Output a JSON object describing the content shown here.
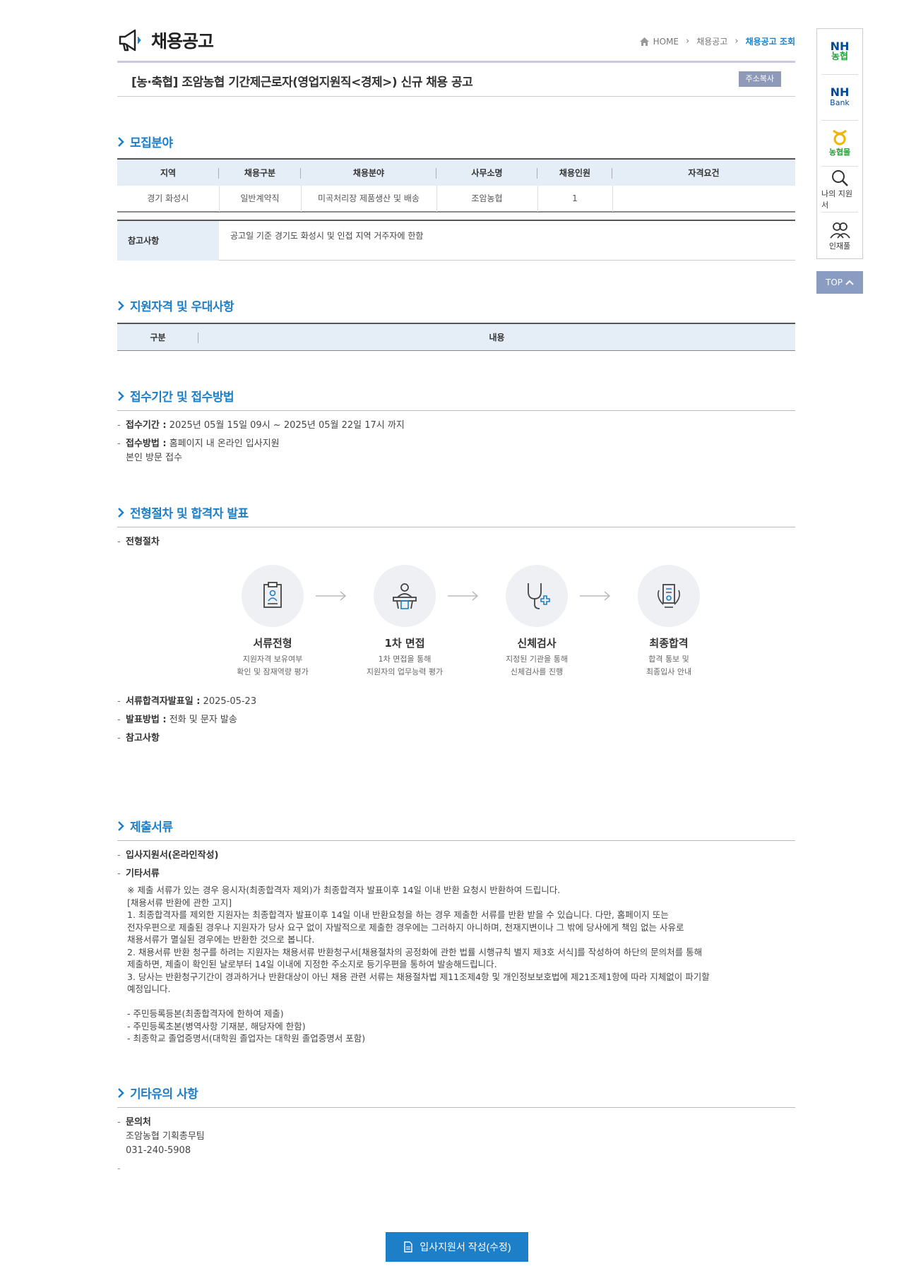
{
  "page": {
    "title": "채용공고",
    "breadcrumb": [
      "HOME",
      "채용공고",
      "채용공고 조회"
    ],
    "subject": "[농·축협] 조암농협 기간제근로자(영업지원직<경제>) 신규 채용 공고",
    "copy_button": "주소복사"
  },
  "sections": {
    "recruit": "모집분야",
    "qualification": "지원자격 및 우대사항",
    "reception": "접수기간 및 접수방법",
    "selection": "전형절차 및 합격자 발표",
    "documents": "제출서류",
    "etc": "기타유의 사항"
  },
  "recruit_table": {
    "headers": [
      "지역",
      "채용구분",
      "채용분야",
      "사무소명",
      "채용인원",
      "자격요건"
    ],
    "rows": [
      [
        "경기 화성시",
        "일반계약직",
        "미곡처리장 제품생산 및 배송",
        "조암농협",
        "1",
        ""
      ]
    ]
  },
  "note": {
    "label": "참고사항",
    "text": "공고일 기준 경기도 화성시 및 인접 지역 거주자에 한함"
  },
  "qual_table": {
    "headers": [
      "구분",
      "내용"
    ]
  },
  "reception": {
    "period_label": "접수기간 :",
    "period": "2025년 05월 15일 09시 ~ 2025년 05월 22일 17시 까지",
    "method_label": "접수방법 :",
    "method": "홈페이지 내 온라인 입사지원",
    "method2": "본인 방문 접수"
  },
  "selection": {
    "process_label": "전형절차",
    "steps": [
      {
        "title": "서류전형",
        "desc1": "지원자격 보유여부",
        "desc2": "확인 및 잠재역량 평가",
        "icon": "document-icon"
      },
      {
        "title": "1차 면접",
        "desc1": "1차 면접을 통해",
        "desc2": "지원자의 업무능력 평가",
        "icon": "interview-icon"
      },
      {
        "title": "신체검사",
        "desc1": "지정된 기관을 통해",
        "desc2": "신체검사를 진행",
        "icon": "stethoscope-icon"
      },
      {
        "title": "최종합격",
        "desc1": "합격 통보 및",
        "desc2": "최종입사 안내",
        "icon": "award-icon"
      }
    ],
    "doc_date_label": "서류합격자발표일 :",
    "doc_date": "2025-05-23",
    "announce_label": "발표방법 :",
    "announce": "전화 및 문자 발송",
    "note_label": "참고사항"
  },
  "documents": {
    "item1": "입사지원서(온라인작성)",
    "item2": "기타서류",
    "lines": [
      "※ 제출 서류가 있는 경우 응시자(최종합격자 제외)가 최종합격자 발표이후 14일 이내 반환 요청시 반환하여 드립니다.",
      "[채용서류 반환에 관한 고지]",
      " 1. 최종합격자를 제외한 지원자는 최종합격자 발표이후 14일 이내 반환요청을 하는 경우 제출한 서류를 반환 받을 수 있습니다. 다만, 홈페이지 또는",
      "전자우편으로 제출된 경우나 지원자가 당사 요구 없이 자발적으로 제출한 경우에는 그러하지 아니하며, 천재지변이나 그 밖에 당사에게 책임 없는 사유로",
      "채용서류가 멸실된 경우에는 반환한 것으로 봅니다.",
      " 2. 채용서류 반환 청구를 하려는 지원자는 채용서류 반환청구서[채용절차의 공정화에 관한 법률 시행규칙 별지 제3호 서식]를 작성하여 하단의 문의처를 통해",
      "제출하면, 제출이 확인된 날로부터 14일 이내에 지정한 주소지로 등기우편을 통하여 발송해드립니다.",
      " 3. 당사는 반환청구기간이 경과하거나 반환대상이 아닌 채용 관련 서류는 채용절차법 제11조제4항 및 개인정보보호법에 제21조제1항에 따라 지체없이 파기할",
      "예정입니다.",
      "",
      "- 주민등록등본(최종합격자에 한하여 제출)",
      "- 주민등록초본(병역사항 기재분, 해당자에 한함)",
      "- 최종학교 졸업증명서(대학원 졸업자는 대학원 졸업증명서 포함)"
    ]
  },
  "etc": {
    "contact_label": "문의처",
    "contact_org": "조암농협 기획총무팀",
    "contact_phone": "031-240-5908",
    "dash": "-"
  },
  "submit_button": "입사지원서 작성(수정)",
  "quick_menu": {
    "nh_top": "NH",
    "nh_bottom": "농협",
    "bank_top": "NH",
    "bank_bottom": "Bank",
    "mall": "농협몰",
    "my_app": "나의 지원서",
    "talent": "인재풀",
    "top": "TOP"
  },
  "colors": {
    "accent": "#1e7fc9",
    "header_bg": "#e5edf6",
    "nh_green": "#2aa13a",
    "nh_blue": "#004a9a"
  }
}
